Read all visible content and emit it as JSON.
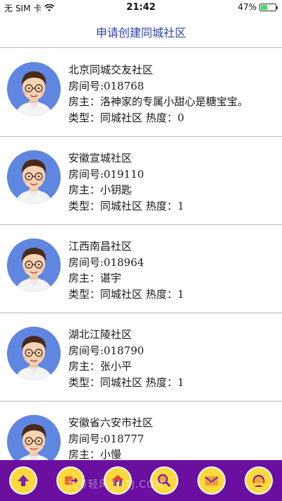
{
  "status_bar": {
    "carrier": "无 SIM 卡",
    "time": "21:42",
    "battery": "47%",
    "battery_level": 0.47
  },
  "header": {
    "title": "申请创建同城社区"
  },
  "communities": [
    {
      "name": "北京同城交友社区",
      "room": "房间号:018768",
      "owner": "房主：洛神家的专属小甜心是糖宝宝。",
      "meta": "类型：同城社区 热度：0"
    },
    {
      "name": "安徽宣城社区",
      "room": "房间号:019110",
      "owner": "房主：小钥匙",
      "meta": "类型：同城社区 热度：1"
    },
    {
      "name": "江西南昌社区",
      "room": "房间号:018964",
      "owner": "房主：谌宇",
      "meta": "类型：同城社区 热度：1"
    },
    {
      "name": "湖北江陵社区",
      "room": "房间号:018790",
      "owner": "房主：张小平",
      "meta": "类型：同城社区 热度：1"
    },
    {
      "name": "安徽省六安市社区",
      "room": "房间号:018777",
      "owner": "房主：小慢",
      "meta": ""
    }
  ],
  "bottom_nav": [
    {
      "name": "nav-up-button",
      "icon": "arrow-up-icon"
    },
    {
      "name": "nav-exchange-button",
      "icon": "exchange-icon"
    },
    {
      "name": "nav-home-button",
      "icon": "home-icon"
    },
    {
      "name": "nav-search-button",
      "icon": "search-icon"
    },
    {
      "name": "nav-mail-button",
      "icon": "mail-icon"
    },
    {
      "name": "nav-service-button",
      "icon": "customer-service-icon"
    }
  ],
  "watermark": "九号轻风 JNTJ.COM",
  "colors": {
    "accent": "#2c3fa8",
    "bottom_bar": "#6b0fa0",
    "nav_button": "#ffd93a",
    "avatar_bg": "#5f86e0"
  }
}
